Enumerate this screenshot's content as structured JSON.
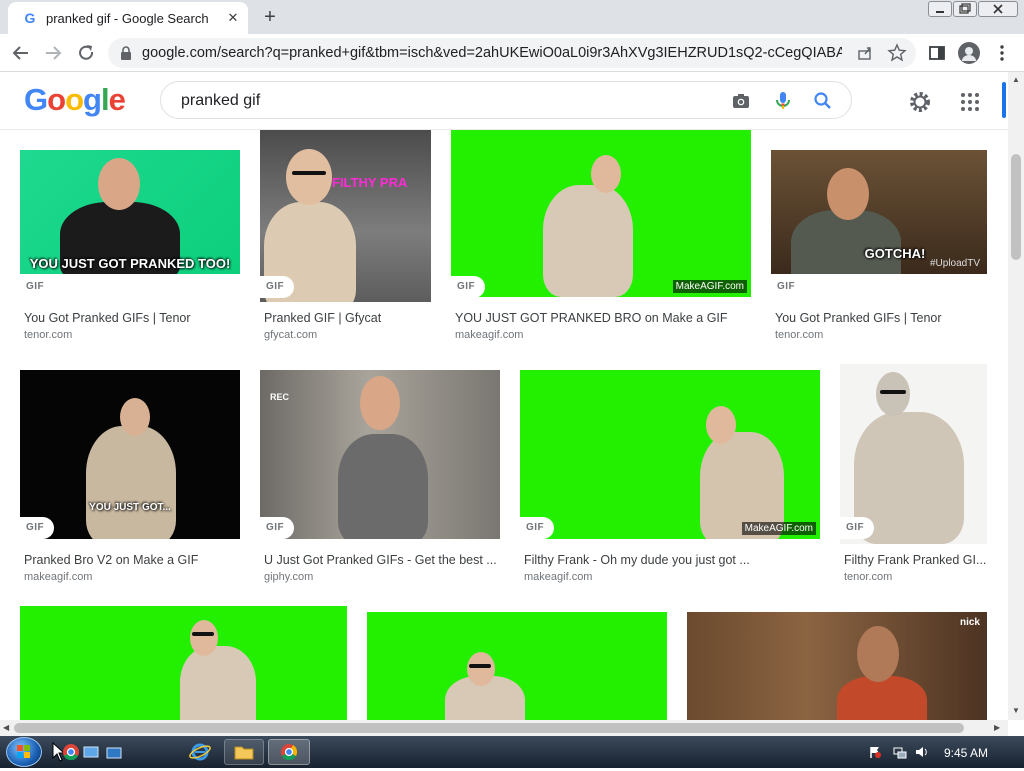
{
  "browser": {
    "tab_title": "pranked gif - Google Search",
    "tab_close": "✕",
    "new_tab": "+",
    "url": "google.com/search?q=pranked+gif&tbm=isch&ved=2ahUKEwiO0aL0i9r3AhXVg3IEHZRUD1sQ2-cCegQIABAA&..."
  },
  "google": {
    "logo_letters": [
      "G",
      "o",
      "o",
      "g",
      "l",
      "e"
    ],
    "logo_colors": [
      "#4285f4",
      "#ea4335",
      "#fbbc05",
      "#4285f4",
      "#34a853",
      "#ea4335"
    ],
    "query": "pranked gif"
  },
  "badge": "GIF",
  "results": [
    {
      "title": "You Got Pranked GIFs | Tenor",
      "domain": "tenor.com",
      "caption": "YOU JUST GOT PRANKED TOO!"
    },
    {
      "title": "Pranked GIF | Gfycat",
      "domain": "gfycat.com",
      "caption": "FILTHY PRA"
    },
    {
      "title": "YOU JUST GOT PRANKED BRO on Make a GIF",
      "domain": "makeagif.com",
      "watermark": "MakeAGIF.com"
    },
    {
      "title": "You Got Pranked GIFs | Tenor",
      "domain": "tenor.com",
      "caption": "GOTCHA!",
      "watermark": "#UploadTV"
    },
    {
      "title": "Pranked Bro V2 on Make a GIF",
      "domain": "makeagif.com",
      "caption": "YOU JUST GOT..."
    },
    {
      "title": "U Just Got Pranked GIFs - Get the best ...",
      "domain": "giphy.com",
      "caption": "REC"
    },
    {
      "title": "Filthy Frank - Oh my dude you just got ...",
      "domain": "makeagif.com",
      "watermark": "MakeAGIF.com"
    },
    {
      "title": "Filthy Frank Pranked GI...",
      "domain": "tenor.com"
    },
    {
      "title": "",
      "domain": ""
    },
    {
      "title": "",
      "domain": ""
    },
    {
      "title": "",
      "domain": "",
      "watermark": "nick"
    }
  ],
  "taskbar": {
    "clock": "9:45 AM"
  }
}
